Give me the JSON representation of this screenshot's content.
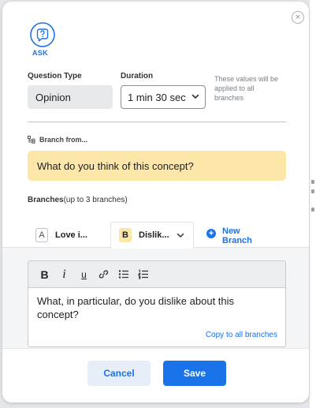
{
  "header": {
    "ask_label": "ASK",
    "close_glyph": "×"
  },
  "form": {
    "question_type_label": "Question Type",
    "question_type_value": "Opinion",
    "duration_label": "Duration",
    "duration_value": "1 min 30 sec",
    "values_note": "These values will be applied to all branches"
  },
  "branch_from": {
    "label": "Branch from...",
    "question": "What do you think of this concept?"
  },
  "branches": {
    "label": "Branches",
    "hint": "(up to 3 branches)",
    "tabs": [
      {
        "letter": "A",
        "label": "Love i..."
      },
      {
        "letter": "B",
        "label": "Dislik..."
      }
    ],
    "new_branch_label": "New Branch",
    "new_branch_glyph": "+"
  },
  "editor": {
    "toolbar": [
      "B",
      "i",
      "u"
    ],
    "text": "What, in particular, do you dislike about this concept?",
    "copy_link": "Copy to all branches"
  },
  "footer": {
    "cancel_label": "Cancel",
    "save_label": "Save"
  },
  "colors": {
    "accent": "#1a73e8",
    "highlight": "#fde7a8",
    "panel_bg": "#f4f5f7"
  },
  "icons": [
    "close-icon",
    "ask-bubble-icon",
    "branch-icon",
    "chevron-down-icon",
    "plus-circle-icon",
    "link-icon",
    "bullet-list-icon",
    "numbered-list-icon"
  ]
}
